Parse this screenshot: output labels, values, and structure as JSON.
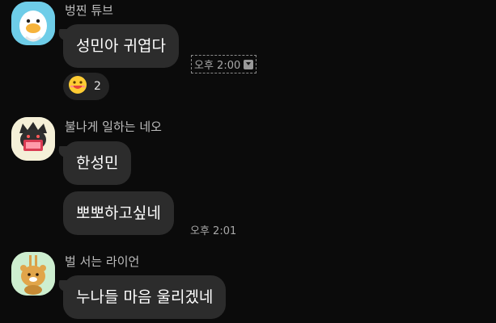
{
  "messages": [
    {
      "sender": "벙찐 튜브",
      "avatar_icon": "tube-duck-avatar-icon",
      "bubbles": [
        "성민아 귀엽다"
      ],
      "time": "오후 2:00",
      "reaction": {
        "icon": "grinning-emoji-icon",
        "count": "2"
      }
    },
    {
      "sender": "불나게 일하는 네오",
      "avatar_icon": "neo-working-avatar-icon",
      "bubbles": [
        "한성민",
        "뽀뽀하고싶네"
      ],
      "time": "오후 2:01"
    },
    {
      "sender": "벌 서는 라이언",
      "avatar_icon": "ryan-punished-avatar-icon",
      "bubbles": [
        "누나들 마음 울리겠네"
      ]
    }
  ],
  "colors": {
    "background": "#0b0b0b",
    "bubble": "#2c2c2c",
    "sender_text": "#bdbdbd",
    "time_text": "#a8a8a8"
  }
}
